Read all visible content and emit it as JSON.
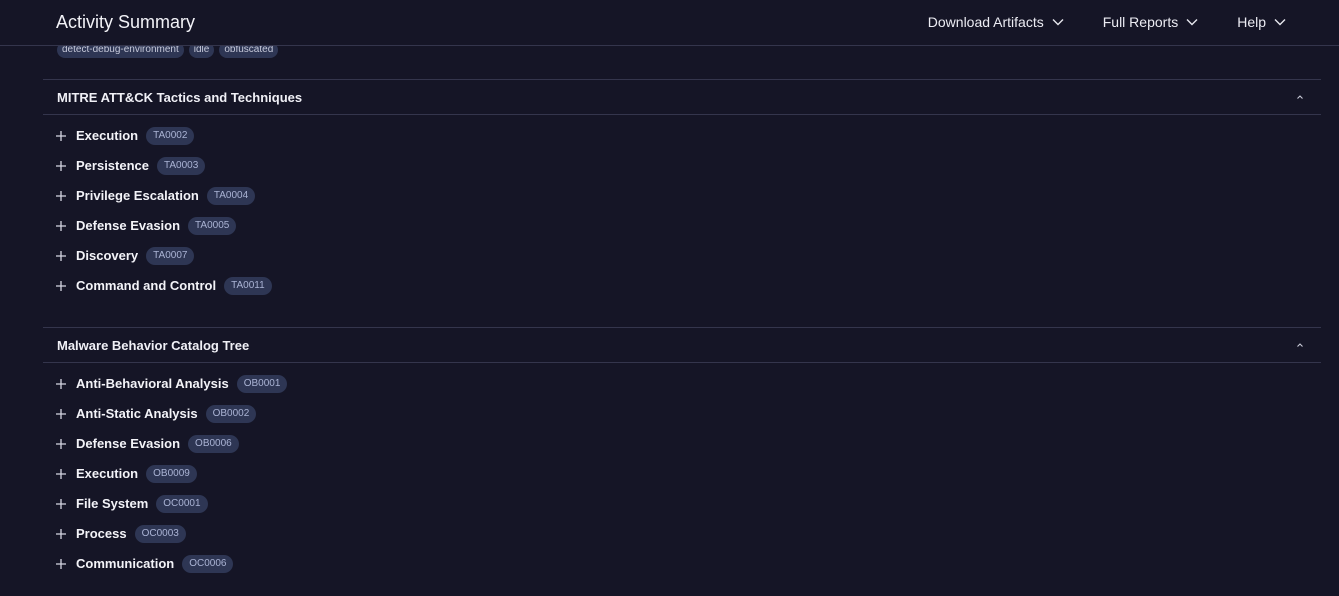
{
  "header": {
    "title": "Activity Summary",
    "menus": [
      {
        "label": "Download Artifacts"
      },
      {
        "label": "Full Reports"
      },
      {
        "label": "Help"
      }
    ]
  },
  "top_tags": [
    "detect-debug-environment",
    "idle",
    "obfuscated"
  ],
  "mitre": {
    "title": "MITRE ATT&CK Tactics and Techniques",
    "items": [
      {
        "label": "Execution",
        "id": "TA0002"
      },
      {
        "label": "Persistence",
        "id": "TA0003"
      },
      {
        "label": "Privilege Escalation",
        "id": "TA0004"
      },
      {
        "label": "Defense Evasion",
        "id": "TA0005"
      },
      {
        "label": "Discovery",
        "id": "TA0007"
      },
      {
        "label": "Command and Control",
        "id": "TA0011"
      }
    ]
  },
  "mbc": {
    "title": "Malware Behavior Catalog Tree",
    "items": [
      {
        "label": "Anti-Behavioral Analysis",
        "id": "OB0001"
      },
      {
        "label": "Anti-Static Analysis",
        "id": "OB0002"
      },
      {
        "label": "Defense Evasion",
        "id": "OB0006"
      },
      {
        "label": "Execution",
        "id": "OB0009"
      },
      {
        "label": "File System",
        "id": "OC0001"
      },
      {
        "label": "Process",
        "id": "OC0003"
      },
      {
        "label": "Communication",
        "id": "OC0006"
      }
    ]
  },
  "colors": {
    "background": "#151526",
    "tag_background": "#2e3654",
    "divider": "#34354c"
  }
}
